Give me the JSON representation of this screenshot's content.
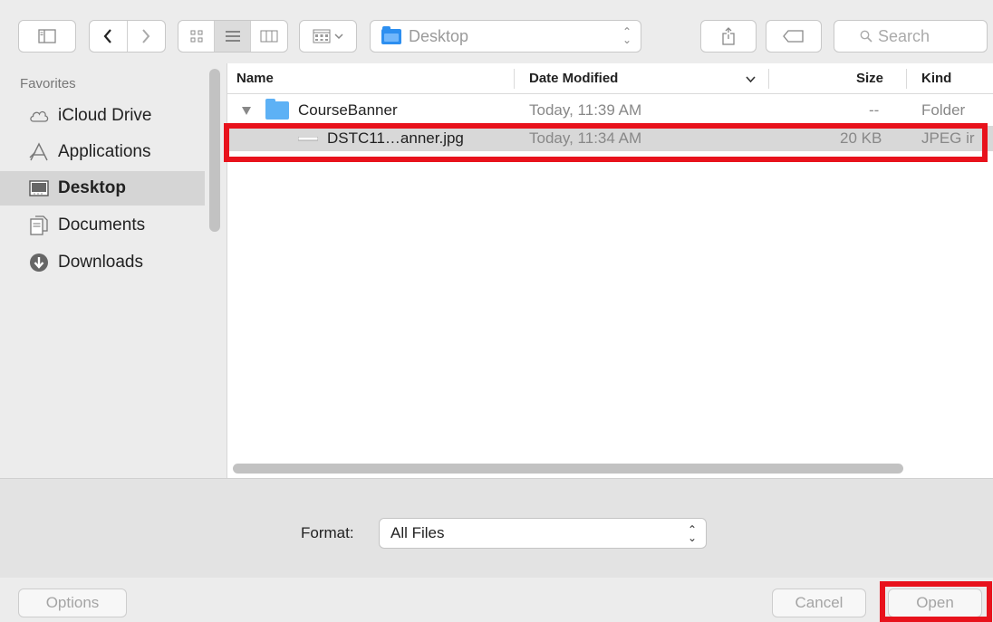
{
  "toolbar": {
    "icons": {
      "sidebar_toggle": "sidebar-icon",
      "back": "chevron-left-icon",
      "forward": "chevron-right-icon",
      "icon_view": "icon-view-icon",
      "list_view": "list-view-icon",
      "column_view": "column-view-icon",
      "group_by": "group-icon",
      "share": "share-icon",
      "tag": "tag-icon",
      "search": "search-icon"
    },
    "location": "Desktop",
    "search_placeholder": "Search"
  },
  "sidebar": {
    "heading": "Favorites",
    "items": [
      {
        "label": "iCloud Drive",
        "icon": "cloud-icon"
      },
      {
        "label": "Applications",
        "icon": "applications-icon"
      },
      {
        "label": "Desktop",
        "icon": "desktop-icon",
        "selected": true
      },
      {
        "label": "Documents",
        "icon": "documents-icon"
      },
      {
        "label": "Downloads",
        "icon": "downloads-icon"
      }
    ]
  },
  "filelist": {
    "columns": {
      "name": "Name",
      "date": "Date Modified",
      "size": "Size",
      "kind": "Kind"
    },
    "rows": [
      {
        "name": "CourseBanner",
        "date": "Today, 11:39 AM",
        "size": "--",
        "kind": "Folder"
      },
      {
        "name": "DSTC11…anner.jpg",
        "date": "Today, 11:34 AM",
        "size": "20 KB",
        "kind": "JPEG ir"
      }
    ]
  },
  "format": {
    "label": "Format:",
    "value": "All Files"
  },
  "buttons": {
    "options": "Options",
    "cancel": "Cancel",
    "open": "Open"
  },
  "colors": {
    "highlight": "#e8121c",
    "folder": "#5db1f5"
  }
}
